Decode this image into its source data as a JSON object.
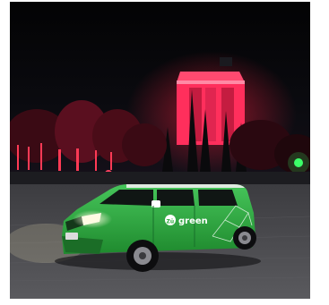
{
  "photo": {
    "logo_badge": "Zü",
    "logo_word": "green"
  },
  "colors": {
    "sky": "#050507",
    "monument_light": "#ff2f5c",
    "van_green": "#2fae3f",
    "pavement": "#4a4a4d"
  }
}
